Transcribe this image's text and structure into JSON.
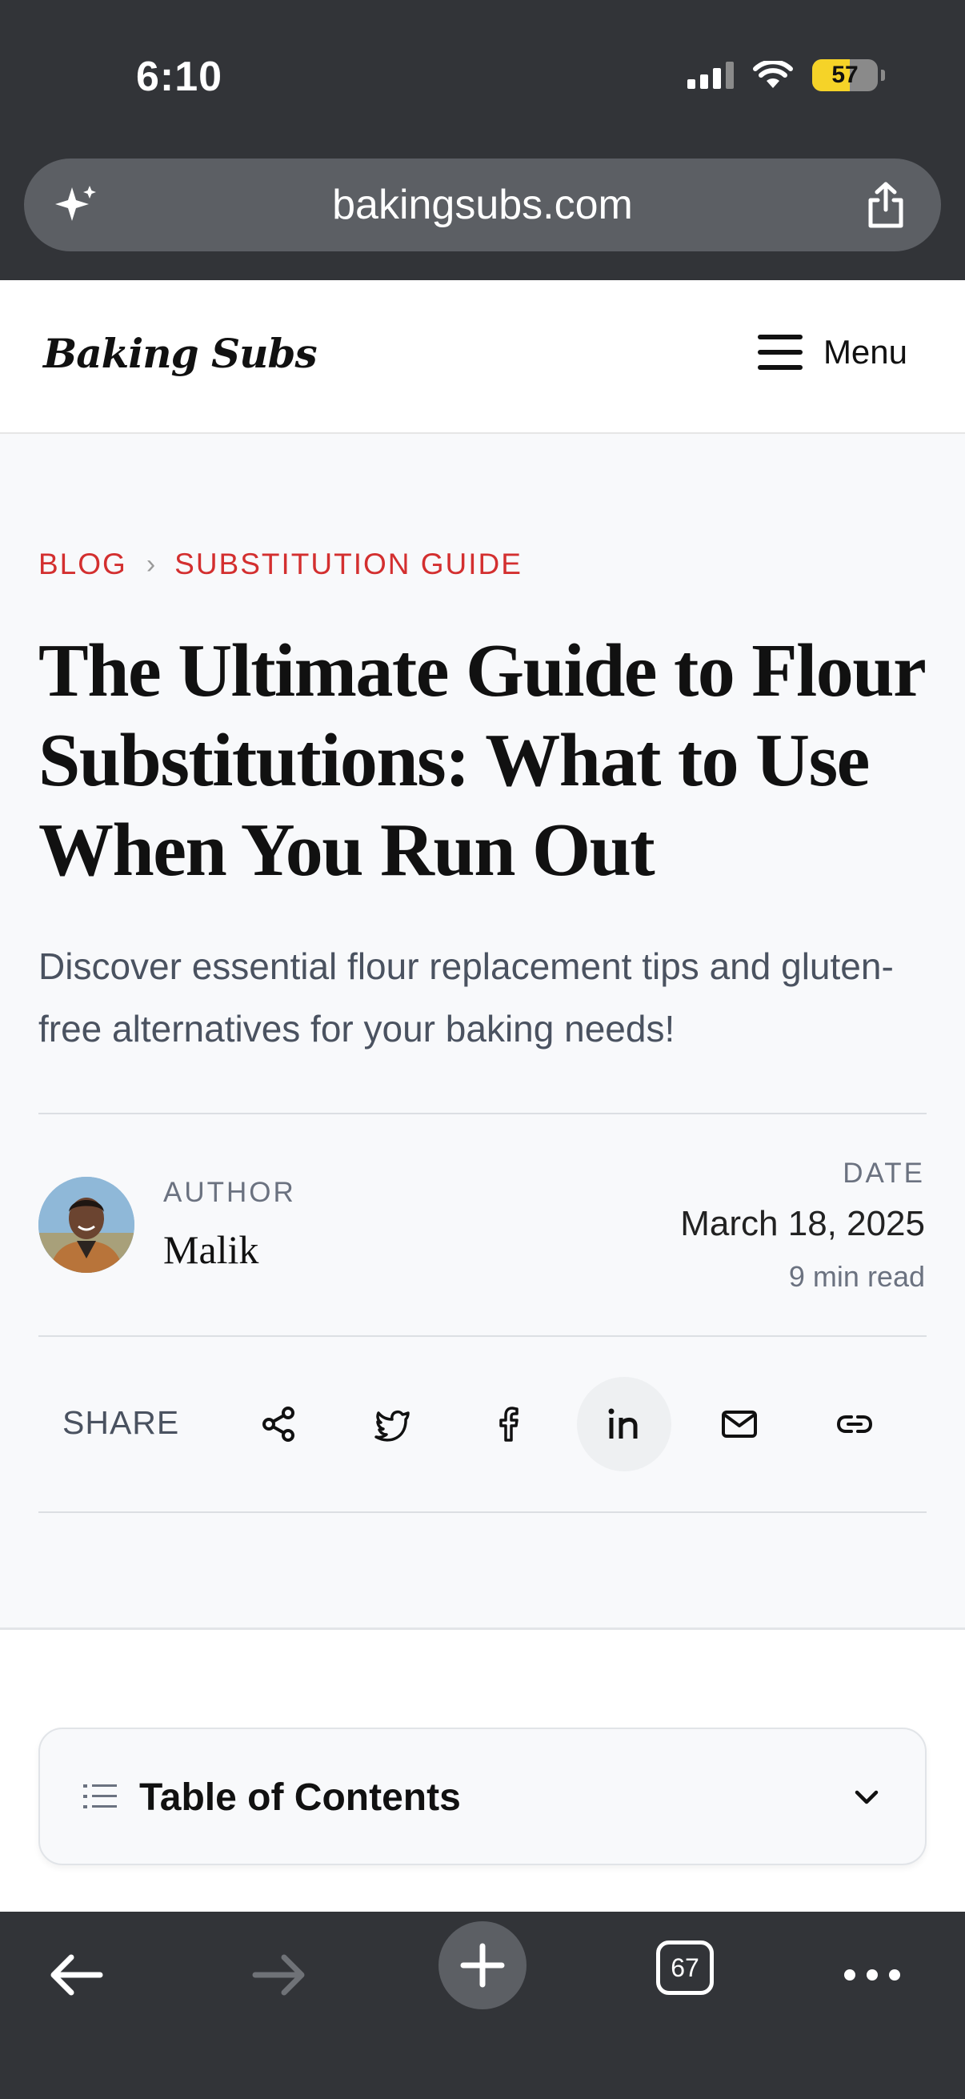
{
  "status_bar": {
    "time": "6:10",
    "battery": "57",
    "battery_level": 0.57
  },
  "browser": {
    "url": "bakingsubs.com",
    "tab_count": "67"
  },
  "site": {
    "logo": "Baking Subs",
    "menu_label": "Menu"
  },
  "article": {
    "breadcrumb": {
      "blog": "BLOG",
      "separator": "›",
      "category": "SUBSTITUTION GUIDE"
    },
    "title": "The Ultimate Guide to Flour Substitutions: What to Use When You Run Out",
    "subtitle": "Discover essential flour replacement tips and gluten-free alternatives for your baking needs!",
    "author_label": "AUTHOR",
    "author_name": "Malik",
    "date_label": "DATE",
    "date": "March 18, 2025",
    "read_time": "9 min read",
    "share_label": "SHARE",
    "share_icons": [
      "share-icon",
      "twitter-icon",
      "facebook-icon",
      "linkedin-icon",
      "mail-icon",
      "link-icon"
    ]
  },
  "toc": {
    "label": "Table of Contents",
    "expanded": false
  },
  "colors": {
    "accent": "#d32f2f",
    "chrome": "#323438",
    "page_bg": "#f8f9fb",
    "battery": "#f5d328"
  }
}
